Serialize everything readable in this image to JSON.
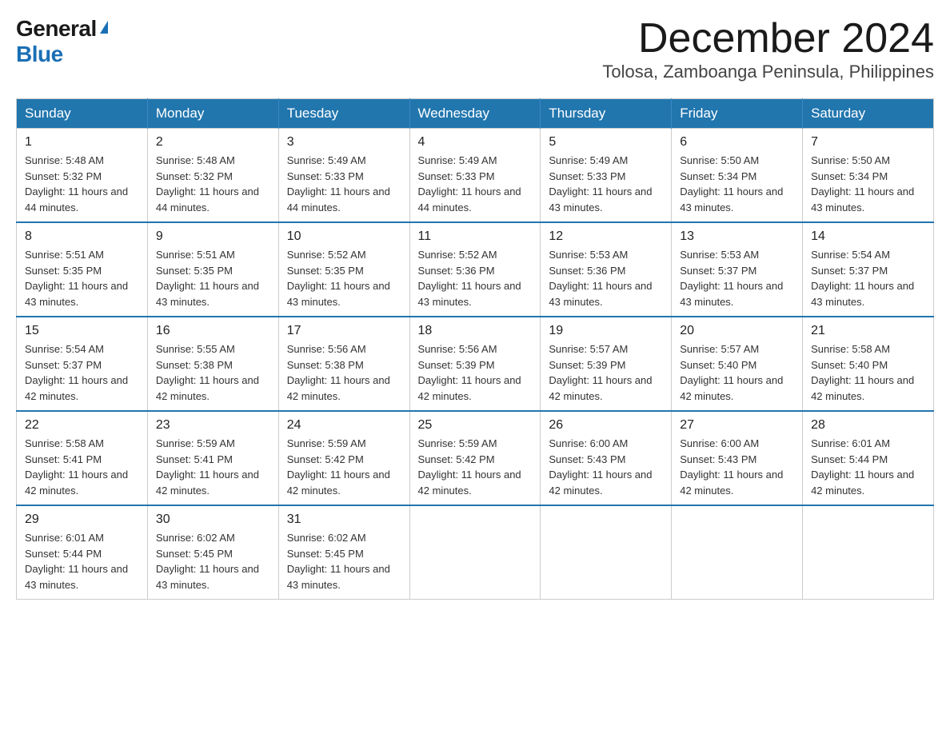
{
  "header": {
    "logo_general": "General",
    "logo_blue": "Blue",
    "month_title": "December 2024",
    "location": "Tolosa, Zamboanga Peninsula, Philippines"
  },
  "weekdays": [
    "Sunday",
    "Monday",
    "Tuesday",
    "Wednesday",
    "Thursday",
    "Friday",
    "Saturday"
  ],
  "weeks": [
    [
      {
        "day": "1",
        "sunrise": "5:48 AM",
        "sunset": "5:32 PM",
        "daylight": "11 hours and 44 minutes."
      },
      {
        "day": "2",
        "sunrise": "5:48 AM",
        "sunset": "5:32 PM",
        "daylight": "11 hours and 44 minutes."
      },
      {
        "day": "3",
        "sunrise": "5:49 AM",
        "sunset": "5:33 PM",
        "daylight": "11 hours and 44 minutes."
      },
      {
        "day": "4",
        "sunrise": "5:49 AM",
        "sunset": "5:33 PM",
        "daylight": "11 hours and 44 minutes."
      },
      {
        "day": "5",
        "sunrise": "5:49 AM",
        "sunset": "5:33 PM",
        "daylight": "11 hours and 43 minutes."
      },
      {
        "day": "6",
        "sunrise": "5:50 AM",
        "sunset": "5:34 PM",
        "daylight": "11 hours and 43 minutes."
      },
      {
        "day": "7",
        "sunrise": "5:50 AM",
        "sunset": "5:34 PM",
        "daylight": "11 hours and 43 minutes."
      }
    ],
    [
      {
        "day": "8",
        "sunrise": "5:51 AM",
        "sunset": "5:35 PM",
        "daylight": "11 hours and 43 minutes."
      },
      {
        "day": "9",
        "sunrise": "5:51 AM",
        "sunset": "5:35 PM",
        "daylight": "11 hours and 43 minutes."
      },
      {
        "day": "10",
        "sunrise": "5:52 AM",
        "sunset": "5:35 PM",
        "daylight": "11 hours and 43 minutes."
      },
      {
        "day": "11",
        "sunrise": "5:52 AM",
        "sunset": "5:36 PM",
        "daylight": "11 hours and 43 minutes."
      },
      {
        "day": "12",
        "sunrise": "5:53 AM",
        "sunset": "5:36 PM",
        "daylight": "11 hours and 43 minutes."
      },
      {
        "day": "13",
        "sunrise": "5:53 AM",
        "sunset": "5:37 PM",
        "daylight": "11 hours and 43 minutes."
      },
      {
        "day": "14",
        "sunrise": "5:54 AM",
        "sunset": "5:37 PM",
        "daylight": "11 hours and 43 minutes."
      }
    ],
    [
      {
        "day": "15",
        "sunrise": "5:54 AM",
        "sunset": "5:37 PM",
        "daylight": "11 hours and 42 minutes."
      },
      {
        "day": "16",
        "sunrise": "5:55 AM",
        "sunset": "5:38 PM",
        "daylight": "11 hours and 42 minutes."
      },
      {
        "day": "17",
        "sunrise": "5:56 AM",
        "sunset": "5:38 PM",
        "daylight": "11 hours and 42 minutes."
      },
      {
        "day": "18",
        "sunrise": "5:56 AM",
        "sunset": "5:39 PM",
        "daylight": "11 hours and 42 minutes."
      },
      {
        "day": "19",
        "sunrise": "5:57 AM",
        "sunset": "5:39 PM",
        "daylight": "11 hours and 42 minutes."
      },
      {
        "day": "20",
        "sunrise": "5:57 AM",
        "sunset": "5:40 PM",
        "daylight": "11 hours and 42 minutes."
      },
      {
        "day": "21",
        "sunrise": "5:58 AM",
        "sunset": "5:40 PM",
        "daylight": "11 hours and 42 minutes."
      }
    ],
    [
      {
        "day": "22",
        "sunrise": "5:58 AM",
        "sunset": "5:41 PM",
        "daylight": "11 hours and 42 minutes."
      },
      {
        "day": "23",
        "sunrise": "5:59 AM",
        "sunset": "5:41 PM",
        "daylight": "11 hours and 42 minutes."
      },
      {
        "day": "24",
        "sunrise": "5:59 AM",
        "sunset": "5:42 PM",
        "daylight": "11 hours and 42 minutes."
      },
      {
        "day": "25",
        "sunrise": "5:59 AM",
        "sunset": "5:42 PM",
        "daylight": "11 hours and 42 minutes."
      },
      {
        "day": "26",
        "sunrise": "6:00 AM",
        "sunset": "5:43 PM",
        "daylight": "11 hours and 42 minutes."
      },
      {
        "day": "27",
        "sunrise": "6:00 AM",
        "sunset": "5:43 PM",
        "daylight": "11 hours and 42 minutes."
      },
      {
        "day": "28",
        "sunrise": "6:01 AM",
        "sunset": "5:44 PM",
        "daylight": "11 hours and 42 minutes."
      }
    ],
    [
      {
        "day": "29",
        "sunrise": "6:01 AM",
        "sunset": "5:44 PM",
        "daylight": "11 hours and 43 minutes."
      },
      {
        "day": "30",
        "sunrise": "6:02 AM",
        "sunset": "5:45 PM",
        "daylight": "11 hours and 43 minutes."
      },
      {
        "day": "31",
        "sunrise": "6:02 AM",
        "sunset": "5:45 PM",
        "daylight": "11 hours and 43 minutes."
      },
      null,
      null,
      null,
      null
    ]
  ],
  "labels": {
    "sunrise": "Sunrise:",
    "sunset": "Sunset:",
    "daylight": "Daylight:"
  }
}
